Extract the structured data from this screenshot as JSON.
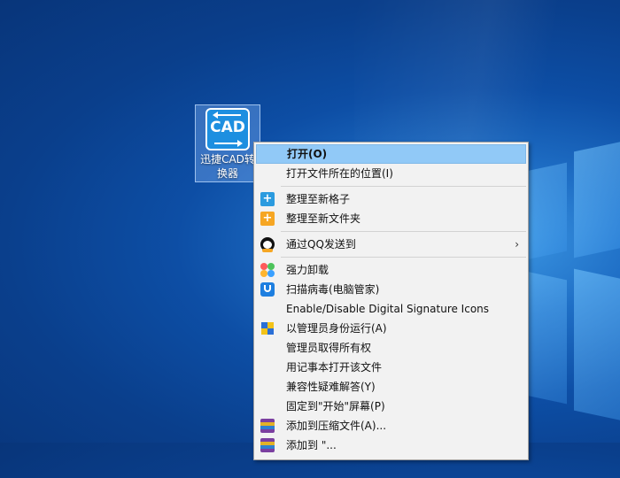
{
  "desktop": {
    "icon": {
      "tile_text": "CAD",
      "label": "迅捷CAD转换器"
    }
  },
  "menu": {
    "items": [
      {
        "label": "打开(O)",
        "icon": "",
        "bold": true,
        "hover": true
      },
      {
        "label": "打开文件所在的位置(I)",
        "icon": ""
      },
      {
        "sep": true
      },
      {
        "label": "整理至新格子",
        "icon": "plus-box-icon"
      },
      {
        "label": "整理至新文件夹",
        "icon": "folder-plus-icon"
      },
      {
        "sep": true
      },
      {
        "label": "通过QQ发送到",
        "icon": "qq-penguin-icon",
        "submenu": true,
        "submenu_glyph": "›"
      },
      {
        "sep": true
      },
      {
        "label": "强力卸载",
        "icon": "flower-uninstall-icon"
      },
      {
        "label": "扫描病毒(电脑管家)",
        "icon": "shield-scan-icon"
      },
      {
        "label": "Enable/Disable Digital Signature Icons",
        "icon": ""
      },
      {
        "label": "以管理员身份运行(A)",
        "icon": "uac-shield-icon"
      },
      {
        "label": "管理员取得所有权",
        "icon": ""
      },
      {
        "label": "用记事本打开该文件",
        "icon": ""
      },
      {
        "label": "兼容性疑难解答(Y)",
        "icon": ""
      },
      {
        "label": "固定到\"开始\"屏幕(P)",
        "icon": ""
      },
      {
        "label": "添加到压缩文件(A)...",
        "icon": "winrar-icon"
      },
      {
        "label": "添加到 \"...",
        "icon": "winrar-icon"
      }
    ]
  },
  "colors": {
    "hover_bg": "#91c9f7",
    "menu_bg": "#f2f2f2",
    "desktop_blue": "#0d4ea5"
  }
}
